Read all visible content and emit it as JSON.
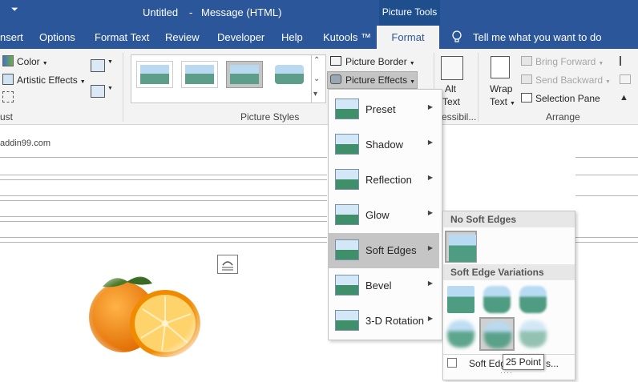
{
  "titlebar": {
    "qat_label": "⏷",
    "doc_title": "Untitled",
    "dash": "-",
    "window_title": "Message (HTML)",
    "context_tab": "Picture Tools"
  },
  "tabs": [
    "nsert",
    "Options",
    "Format Text",
    "Review",
    "Developer",
    "Help",
    "Kutools ™",
    "Format"
  ],
  "tell_me": "Tell me what you want to do",
  "ribbon": {
    "color_label": "Color",
    "artistic_label": "Artistic Effects",
    "adjust_label": "ust",
    "picture_styles_label": "Picture Styles",
    "picture_border_label": "Picture Border",
    "picture_effects_label": "Picture Effects",
    "alt_text_label": "Alt\nText",
    "alt_text_1": "Alt",
    "alt_text_2": "Text",
    "accessibility_label": "essibil...",
    "wrap_text_1": "Wrap",
    "wrap_text_2": "Text",
    "bring_forward_label": "Bring Forward",
    "send_backward_label": "Send Backward",
    "selection_pane_label": "Selection Pane",
    "arrange_label": "Arrange"
  },
  "doc": {
    "from_text": "addin99.com"
  },
  "effects_menu": {
    "items": [
      {
        "label": "Preset",
        "icon": "preset-icon"
      },
      {
        "label": "Shadow",
        "icon": "shadow-icon"
      },
      {
        "label": "Reflection",
        "icon": "reflection-icon"
      },
      {
        "label": "Glow",
        "icon": "glow-icon"
      },
      {
        "label": "Soft Edges",
        "icon": "soft-edges-icon"
      },
      {
        "label": "Bevel",
        "icon": "bevel-icon"
      },
      {
        "label": "3-D Rotation",
        "icon": "rotation-3d-icon"
      }
    ]
  },
  "soft_edges_submenu": {
    "no_soft_edges_heading": "No Soft Edges",
    "variations_heading": "Soft Edge Variations",
    "options_label": "Soft Edg",
    "options_suffix": "s...",
    "tooltip": "25 Point"
  },
  "colors": {
    "title_bar": "#2b579a",
    "ribbon": "#f3f3f3",
    "hover": "#c5c5c5"
  }
}
